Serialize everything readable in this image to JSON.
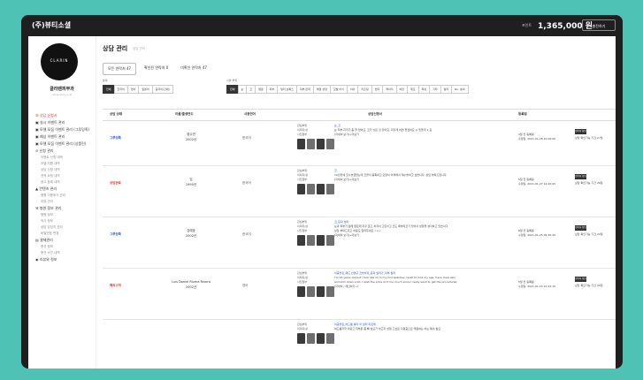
{
  "header": {
    "brand": "(주)뷰티소셜",
    "points_label": "포인트",
    "points": "1,365,000 원",
    "charge_button": "충전하기"
  },
  "sidebar": {
    "logo_text": "CLARIN",
    "clinic_name": "클라렌피부과",
    "clinic_sub": "clarenskin.co.kr",
    "items": [
      {
        "label": "☰ 상담 신청서",
        "type": "active"
      },
      {
        "label": "▣ 실시 이벤트 관리",
        "type": "main"
      },
      {
        "label": "▣ 모델 모집 이벤트 관리 (그루밍족)",
        "type": "main"
      },
      {
        "label": "▣ 예상 이벤트 관리",
        "type": "main"
      },
      {
        "label": "▣ 모델 모집 이벤트 관리 (상품진)",
        "type": "main"
      },
      {
        "label": "⊙ 신청 관리",
        "type": "main"
      },
      {
        "label": "이벤트 신청 내역",
        "type": "sub"
      },
      {
        "label": "모델 지원 내역",
        "type": "sub"
      },
      {
        "label": "상담 신청 내역",
        "type": "sub"
      },
      {
        "label": "견적 요청 내역",
        "type": "sub"
      },
      {
        "label": "광고 등록 내역",
        "type": "sub"
      },
      {
        "label": "▲ 컨텐츠 관리",
        "type": "main"
      },
      {
        "label": "병원 이용후기 관리",
        "type": "sub"
      },
      {
        "label": "리뷰 관리",
        "type": "sub"
      },
      {
        "label": "⚒ 병원 정보 관리",
        "type": "main"
      },
      {
        "label": "병원 정보",
        "type": "sub"
      },
      {
        "label": "의사 정보",
        "type": "sub"
      },
      {
        "label": "상담 담당자 관리",
        "type": "sub"
      },
      {
        "label": "비밀번호 변경",
        "type": "sub"
      },
      {
        "label": "▤ 결제관리",
        "type": "main"
      },
      {
        "label": "충전 정보",
        "type": "sub"
      },
      {
        "label": "충전 소진 내역",
        "type": "sub"
      },
      {
        "label": "◉ 리뷰와 정보",
        "type": "main"
      }
    ]
  },
  "page": {
    "title": "상담 관리",
    "title_sub": "상담 관리",
    "status_tabs": [
      "모든 연락처 47",
      "확인된 연락처 0",
      "미확인 연락처 47"
    ],
    "filter1_label": "분야",
    "filter1": [
      "전체",
      "한국어",
      "영어",
      "일본어",
      "중국어(간체)"
    ],
    "filter2_label": "시술 부위",
    "filter2": [
      "전체",
      "눈",
      "코",
      "얼굴",
      "피부",
      "필러·보톡스",
      "피부 탄력",
      "체형 성형",
      "모발 이식",
      "치아",
      "리프팅",
      "쁘띠",
      "레이저",
      "비만",
      "제모",
      "왁싱",
      "기타",
      "필러",
      "No. 분야"
    ]
  },
  "table": {
    "headers": [
      "상담 상태",
      "이름/출생연도",
      "사용언어",
      "상담신청서",
      "등록일"
    ],
    "rows": [
      {
        "status": "그루밍족",
        "status_color": "blue",
        "name": "정수연",
        "year": "2002년",
        "lang": "한국어",
        "product": [
          "관심부위",
          "이미지/상",
          "사진첨부"
        ],
        "content_title": "눈_코",
        "content_text": [
          "눈 피부 지저가 좀 잘 없어요. 코가 낮은 것 같아요. 피할게 하면 좋겠어요 수 있을까 1 표",
          "[자세히 보기]+더보기"
        ],
        "date": [
          "3일 전 등록됨",
          "수정일: 2021-01-28 10:00:05"
        ],
        "tag": "연락처 확인",
        "tag_note": "상담 확인가능 기간 27일"
      },
      {
        "status": "상담완료",
        "status_color": "red",
        "name": "임",
        "year": "1995년",
        "lang": "한국어",
        "product": [
          "관심부위",
          "이미지/상",
          "사진첨부"
        ],
        "content_title": "코",
        "content_text": [
          "10년전에 코수술했었는데 코끝이 뭉툭하고 모양이 어색해서 재수술하고 싶습니다. 상담 부탁드립니다.",
          "[자세히 보기]+더보기"
        ],
        "date": [
          "5일 전 등록됨",
          "수정일: 2021-01-27 14:20:05"
        ],
        "tag": "연락처 확인",
        "tag_note": "상담 확인가능 기간 26일"
      },
      {
        "status": "그루밍족",
        "status_color": "blue",
        "name": "강예호",
        "year": "2002년",
        "lang": "한국어",
        "product": [
          "관심부위",
          "이미지/상",
          "사진첨부"
        ],
        "content_title": "코_윤곽 필러",
        "content_text": [
          "눈과 피부가 원래 얇은데 자꾸 붓고 처져서 고민이고 코도 매부리코가 있어서 성형을 생각하고 있습니다.",
          "상담 부탁드리고 비용도 알려주세요 >>>",
          "[자세히 보기]+더보기"
        ],
        "date": [
          "8일 전 등록됨",
          "수정일: 2021-01-25 09:30:20"
        ],
        "tag": "연락처 확인",
        "tag_note": "상담 확인가능 기간 22일"
      },
      {
        "status": "해외고객",
        "status_color": "red",
        "name": "Luis Daniel Rivera Rivera",
        "year": "2002년",
        "lang": "영어",
        "product": [
          "관심부위",
          "이미지/상",
          "사진첨부"
        ],
        "content_title": "이중볼집_패드 반영구 코방이지_윤곽 필러가_피부 필러",
        "content_text": [
          "I'm 16 years old but I look like im in my mid twenties I wish to look my age, have clear skin",
          "and slim down a bit. I wish the price isn't too much since I really want to get the procedures.",
          "[자세히 / 해산하기+]"
        ],
        "date": [
          "5일 전 등록됨",
          "수정일: 2021-01-24 10:22:10"
        ],
        "tag": "연락처 확인",
        "tag_note": "상담 확인가능 기간 20일"
      },
      {
        "status": "",
        "status_color": "blue",
        "name": "",
        "year": "",
        "lang": "",
        "product": [
          "관심부위",
          "이미지/상"
        ],
        "content_title": "이중볼집_여드름 흉터 미 필러 피로해",
        "content_text": [
          "여드름자국 이랑고 피부톤 좀 빼 필요가 하고자 성형 고싶로 다원중으로 핵원하는 어는 특이 필요"
        ],
        "date": [],
        "tag": "",
        "tag_note": ""
      }
    ]
  }
}
